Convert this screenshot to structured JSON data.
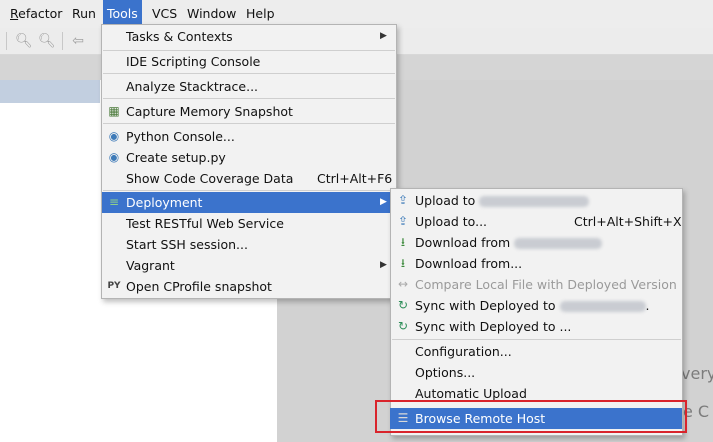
{
  "menubar": {
    "items": [
      {
        "label": "Refactor"
      },
      {
        "label": "Run"
      },
      {
        "label": "Tools"
      },
      {
        "label": "VCS"
      },
      {
        "label": "Window"
      },
      {
        "label": "Help"
      }
    ]
  },
  "background": {
    "right_text_1": "very",
    "right_text_2": "e C"
  },
  "tools_menu": {
    "items": [
      {
        "label": "Tasks & Contexts"
      },
      {
        "label": "IDE Scripting Console"
      },
      {
        "label": "Analyze Stacktrace..."
      },
      {
        "label": "Capture Memory Snapshot"
      },
      {
        "label": "Python Console..."
      },
      {
        "label": "Create setup.py"
      },
      {
        "label": "Show Code Coverage Data",
        "shortcut": "Ctrl+Alt+F6"
      },
      {
        "label": "Deployment"
      },
      {
        "label": "Test RESTful Web Service"
      },
      {
        "label": "Start SSH session..."
      },
      {
        "label": "Vagrant"
      },
      {
        "label": "Open CProfile snapshot"
      }
    ]
  },
  "deployment_menu": {
    "items": [
      {
        "label": "Upload to"
      },
      {
        "label": "Upload to...",
        "shortcut": "Ctrl+Alt+Shift+X"
      },
      {
        "label": "Download from"
      },
      {
        "label": "Download from..."
      },
      {
        "label": "Compare Local File with Deployed Version"
      },
      {
        "label": "Sync with Deployed to",
        "suffix": "."
      },
      {
        "label": "Sync with Deployed to ..."
      },
      {
        "label": "Configuration..."
      },
      {
        "label": "Options..."
      },
      {
        "label": "Automatic Upload"
      },
      {
        "label": "Browse Remote Host"
      }
    ]
  },
  "icons": {
    "toolbar": [
      "zoom-in-icon",
      "zoom-out-icon",
      "back-arrow-icon"
    ],
    "capture_memory": "memory-snapshot-icon",
    "python_console": "python-icon",
    "create_setup": "python-setup-icon",
    "deployment": "deployment-icon",
    "cprofile": "cprofile-icon",
    "upload": "upload-icon",
    "download": "download-icon",
    "compare": "compare-icon",
    "sync": "sync-icon",
    "browse_remote": "server-icon"
  },
  "colors": {
    "highlight": "#3b73cc",
    "annotation_box": "#d9242c",
    "menu_bg": "#f2f2f2"
  }
}
